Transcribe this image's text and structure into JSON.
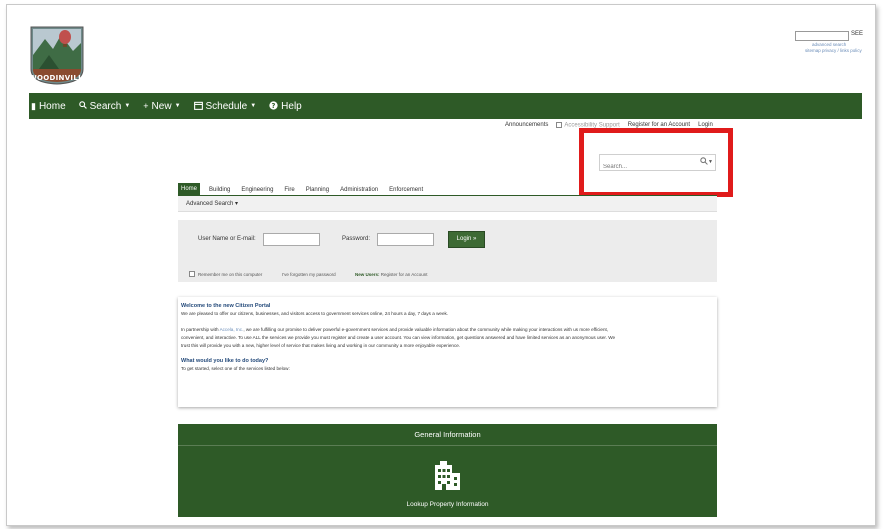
{
  "header": {
    "logo_text": "WOODINVILLE",
    "top_search_button": "SEE",
    "top_adv": "advanced search",
    "top_links": "sitemap  privacy  / links policy"
  },
  "nav": {
    "items": [
      {
        "label": "Home",
        "icon": "home-icon"
      },
      {
        "label": "Search",
        "icon": "search-icon",
        "caret": true
      },
      {
        "label": "New",
        "icon": "plus-icon",
        "caret": true
      },
      {
        "label": "Schedule",
        "icon": "calendar-icon",
        "caret": true
      },
      {
        "label": "Help",
        "icon": "help-icon"
      }
    ]
  },
  "util": {
    "announcements": "Announcements",
    "accessibility": "Accessibility Support",
    "register": "Register for an Account",
    "login": "Login"
  },
  "search": {
    "placeholder": "Search..."
  },
  "tabs": [
    "Home",
    "Building",
    "Engineering",
    "Fire",
    "Planning",
    "Administration",
    "Enforcement"
  ],
  "subtab": {
    "advanced_search": "Advanced Search ▾"
  },
  "login": {
    "username_label": "User Name or E-mail:",
    "password_label": "Password:",
    "button": "Login »",
    "remember": "Remember me on this computer",
    "forgot": "I've forgotten my password",
    "new_users": "New Users:",
    "register": "Register for an Account"
  },
  "welcome": {
    "title": "Welcome to the new Citizen Portal",
    "line1": "We are pleased to offer our citizens, businesses, and visitors access to government services online, 24 hours a day, 7 days a week.",
    "p2_a": "In partnership with ",
    "p2_link": "Accela, Inc.",
    "p2_b": ", we are fulfilling our promise to deliver powerful e-government services and provide valuable information about the community while making your interactions with us more efficient,",
    "p2_line2": "convenient, and interactive. To use ALL the services we provide you must register and create a user account. You can view information, get questions answered and have limited services as an anonymous user. We",
    "p2_line3": "trust this will provide you with a new, higher level of service that makes living and working in our community a more enjoyable experience.",
    "q_title": "What would you like to do today?",
    "q_text": "To get started, select one of the services listed below:"
  },
  "general_info": {
    "header": "General Information",
    "lookup": "Lookup Property Information",
    "icon": "building-icon"
  },
  "colors": {
    "brand_green": "#2e5a27",
    "highlight_red": "#e01b1b"
  }
}
